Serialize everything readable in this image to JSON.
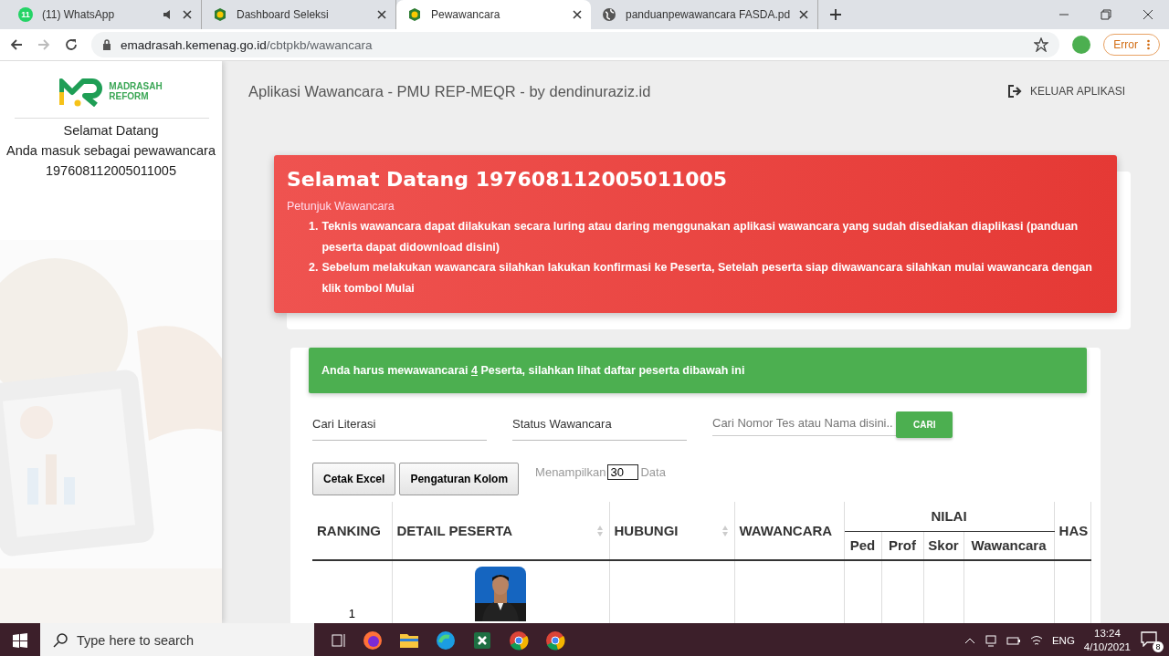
{
  "browser": {
    "tabs": [
      {
        "title": "(11) WhatsApp",
        "badge": "11",
        "kind": "chat",
        "muted_audio": true,
        "selected": false
      },
      {
        "title": "Dashboard Seleksi",
        "kind": "site",
        "muted_audio": false,
        "selected": false
      },
      {
        "title": "Pewawancara",
        "kind": "site",
        "muted_audio": false,
        "selected": true
      },
      {
        "title": "panduanpewawancara FASDA.pd",
        "kind": "web",
        "muted_audio": false,
        "selected": false
      }
    ],
    "url_host": "emadrasah.kemenag.go.id",
    "url_path": "/cbtpkb/wawancara",
    "profile_status": "Error"
  },
  "sidebar": {
    "logo_line1": "MADRASAH",
    "logo_line2": "REFORM",
    "greeting": "Selamat Datang",
    "role": "Anda masuk sebagai pewawancara",
    "user_id": "197608112005011005"
  },
  "header": {
    "title": "Aplikasi Wawancara - PMU REP-MEQR - by dendinuraziz.id",
    "logout": "KELUAR APLIKASI"
  },
  "notice": {
    "title": "Selamat Datang 197608112005011005",
    "subtitle": "Petunjuk Wawancara",
    "items": [
      {
        "marker": "1.",
        "text": "Teknis wawancara dapat dilakukan secara luring atau daring menggunakan aplikasi wawancara yang sudah disediakan diaplikasi (panduan peserta dapat didownload disini)"
      },
      {
        "marker": "2.",
        "text": "Sebelum melakukan wawancara silahkan lakukan konfirmasi ke Peserta, Setelah peserta siap diwawancara silahkan mulai wawancara dengan klik tombol Mulai"
      }
    ]
  },
  "banner": {
    "before": "Anda harus mewawancarai",
    "count": "4",
    "after": "Peserta, silahkan lihat daftar peserta dibawah ini"
  },
  "filters": {
    "literasi": "Cari Literasi",
    "status": "Status Wawancara",
    "search_placeholder": "Cari Nomor Tes atau Nama disini..",
    "search_button": "CARI"
  },
  "toolbar": {
    "buttons": [
      "Cetak Excel",
      "Pengaturan Kolom"
    ],
    "show_label": "Menampilkan",
    "page_size": "30",
    "show_suffix": "Data"
  },
  "table": {
    "columns": [
      {
        "label": "RANKING",
        "sortable": false
      },
      {
        "label": "DETAIL PESERTA",
        "sortable": true
      },
      {
        "label": "HUBUNGI",
        "sortable": true
      },
      {
        "label": "WAWANCARA",
        "sortable": false
      }
    ],
    "group": {
      "label": "NILAI",
      "columns": [
        "Ped",
        "Prof",
        "Skor",
        "Wawancara"
      ]
    },
    "column_cut": "HAS",
    "rows": [
      {
        "ranking": "1",
        "photo": true
      }
    ]
  },
  "taskbar": {
    "search_placeholder": "Type here to search",
    "language": "ENG",
    "time": "13:24",
    "date": "4/10/2021",
    "notifications": "8"
  }
}
